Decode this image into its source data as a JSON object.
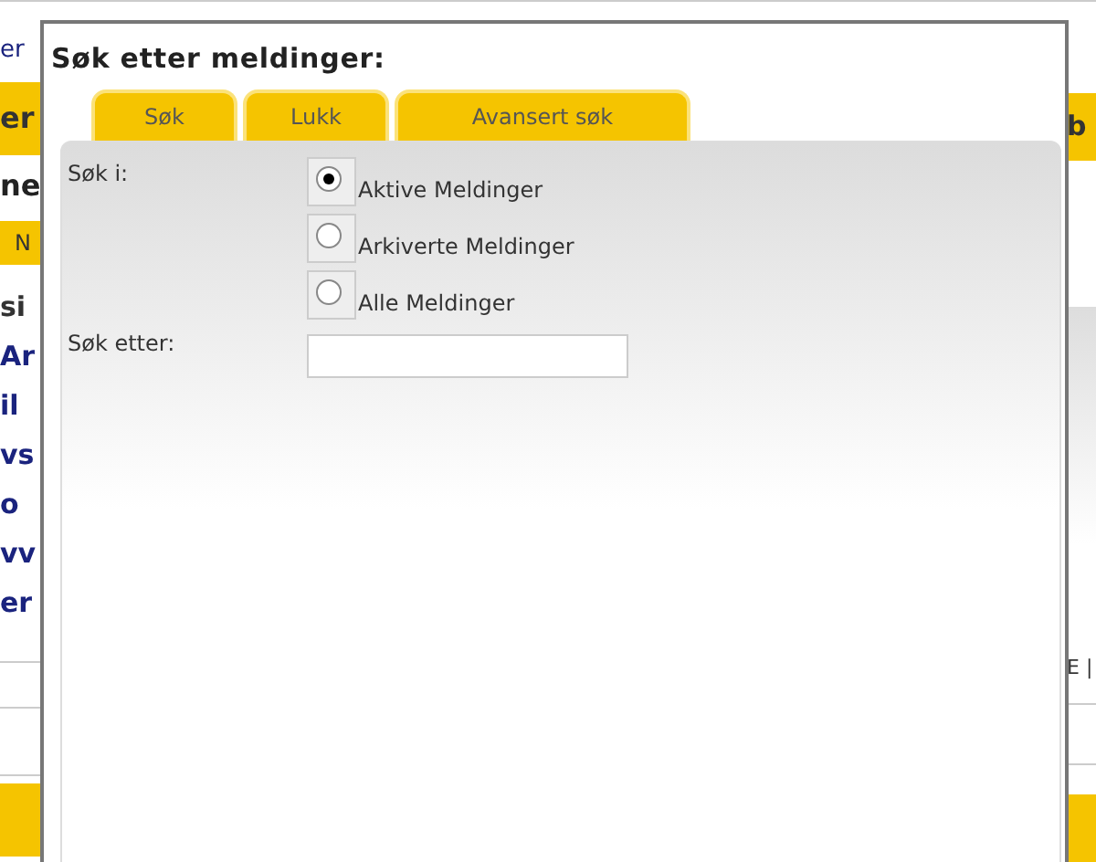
{
  "background_page": {
    "left_fragments": [
      {
        "text": "er",
        "kind": "link"
      },
      {
        "text": "er",
        "kind": "bar"
      },
      {
        "text": "ne",
        "kind": "heading"
      },
      {
        "text": "N",
        "kind": "tab"
      },
      {
        "text": "si",
        "kind": "label"
      },
      {
        "text": "Ar",
        "kind": "link"
      },
      {
        "text": "il",
        "kind": "link"
      },
      {
        "text": "vs",
        "kind": "link"
      },
      {
        "text": "o",
        "kind": "link"
      },
      {
        "text": "vv",
        "kind": "link"
      },
      {
        "text": "er",
        "kind": "link"
      }
    ],
    "right_fragments": [
      {
        "text": "b",
        "kind": "bar"
      },
      {
        "text": "E |",
        "kind": "footer"
      }
    ]
  },
  "dialog": {
    "title": "Søk etter meldinger:",
    "tabs": [
      {
        "label": "Søk"
      },
      {
        "label": "Lukk"
      },
      {
        "label": "Avansert søk"
      }
    ],
    "search_in_label": "Søk i:",
    "options": [
      {
        "label": "Aktive Meldinger",
        "checked": true
      },
      {
        "label": "Arkiverte Meldinger",
        "checked": false
      },
      {
        "label": "Alle Meldinger",
        "checked": false
      }
    ],
    "search_for_label": "Søk etter:"
  }
}
